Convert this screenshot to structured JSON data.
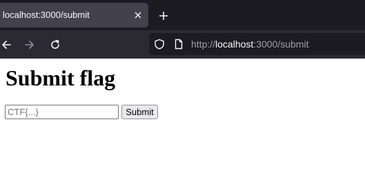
{
  "browser": {
    "tab": {
      "title": "localhost:3000/submit",
      "close_icon": "close-icon"
    },
    "new_tab_icon": "plus-icon",
    "nav": {
      "back_icon": "arrow-left-icon",
      "forward_icon": "arrow-right-icon",
      "reload_icon": "reload-icon"
    },
    "urlbar": {
      "shield_icon": "shield-icon",
      "page_icon": "page-icon",
      "scheme": "http://",
      "host": "localhost",
      "path": ":3000/submit"
    }
  },
  "page": {
    "title": "Submit flag",
    "flag_input": {
      "placeholder": "CTF{...}",
      "value": ""
    },
    "submit_label": "Submit"
  },
  "colors": {
    "tab_strip_bg": "#1c1b22",
    "active_tab_bg": "#42414d",
    "nav_bar_bg": "#2b2a33",
    "urlbar_bg": "#1c1b22",
    "page_bg": "#ffffff"
  }
}
